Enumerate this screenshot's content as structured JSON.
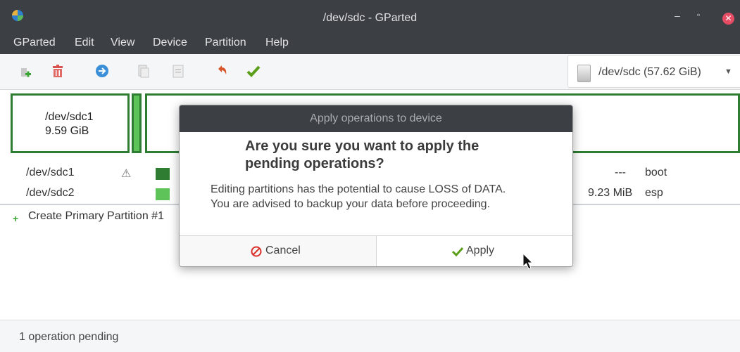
{
  "window": {
    "title": "/dev/sdc - GParted"
  },
  "menubar": [
    "GParted",
    "Edit",
    "View",
    "Device",
    "Partition",
    "Help"
  ],
  "toolbar": {
    "icons": [
      "new-partition-icon",
      "delete-icon",
      "resize-move-icon",
      "copy-icon",
      "paste-icon",
      "undo-icon",
      "apply-icon"
    ]
  },
  "device_selector": {
    "label": "/dev/sdc (57.62 GiB)"
  },
  "map": {
    "partition1": {
      "name": "/dev/sdc1",
      "size": "9.59 GiB"
    }
  },
  "partitions": [
    {
      "device": "/dev/sdc1",
      "used": "---",
      "flags": "boot",
      "color": "#2e7d32"
    },
    {
      "device": "/dev/sdc2",
      "used": "9.23 MiB",
      "flags": "esp",
      "color": "#5ec45a"
    }
  ],
  "operations": [
    "Create Primary Partition #1"
  ],
  "status": {
    "text": "1 operation pending"
  },
  "dialog": {
    "title": "Apply operations to device",
    "question_line1": "Are you sure you want to apply the",
    "question_line2": "pending operations?",
    "message_line1": "Editing partitions has the potential to cause LOSS of DATA.",
    "message_line2": "You are advised to backup your data before proceeding.",
    "cancel_label": "Cancel",
    "apply_label": "Apply"
  },
  "colors": {
    "titlebar": "#3c3f44",
    "partition_border": "#2e7d32",
    "close_button": "#e64c64"
  }
}
